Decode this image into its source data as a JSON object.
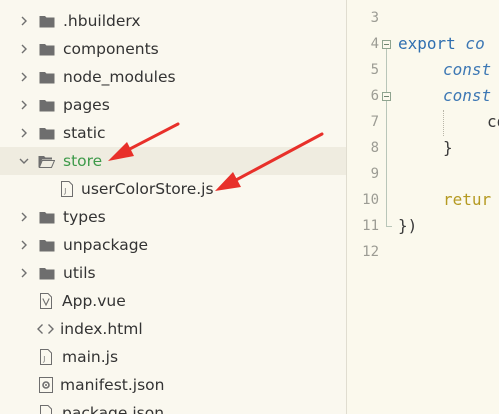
{
  "file_tree": {
    "items": [
      {
        "label": ".hbuilderx",
        "kind": "folder",
        "expanded": false
      },
      {
        "label": "components",
        "kind": "folder",
        "expanded": false
      },
      {
        "label": "node_modules",
        "kind": "folder",
        "expanded": false
      },
      {
        "label": "pages",
        "kind": "folder",
        "expanded": false
      },
      {
        "label": "static",
        "kind": "folder",
        "expanded": false
      },
      {
        "label": "store",
        "kind": "folder",
        "expanded": true,
        "selected": true
      },
      {
        "label": "userColorStore.js",
        "kind": "js-file"
      },
      {
        "label": "types",
        "kind": "folder",
        "expanded": false
      },
      {
        "label": "unpackage",
        "kind": "folder",
        "expanded": false
      },
      {
        "label": "utils",
        "kind": "folder",
        "expanded": false
      },
      {
        "label": "App.vue",
        "kind": "vue-file"
      },
      {
        "label": "index.html",
        "kind": "html-file"
      },
      {
        "label": "main.js",
        "kind": "js-file"
      },
      {
        "label": "manifest.json",
        "kind": "json-file"
      },
      {
        "label": "package.json",
        "kind": "file"
      }
    ]
  },
  "editor": {
    "lines": [
      {
        "num": "3",
        "text": ""
      },
      {
        "num": "4",
        "kw": "export",
        "rest": " co"
      },
      {
        "num": "5",
        "kw": "const",
        "rest": ""
      },
      {
        "num": "6",
        "kw": "const",
        "rest": ""
      },
      {
        "num": "7",
        "kw": "",
        "rest": "co"
      },
      {
        "num": "8",
        "kw": "",
        "rest": "}"
      },
      {
        "num": "9",
        "kw": "",
        "rest": ""
      },
      {
        "num": "10",
        "kw": "retur",
        "rest": ""
      },
      {
        "num": "11",
        "kw": "",
        "rest": "})"
      },
      {
        "num": "12",
        "kw": "",
        "rest": ""
      }
    ]
  },
  "colors": {
    "selected_label": "#3e9a4a",
    "keyword": "#2f6fb0",
    "return_keyword": "#b59a22",
    "annotation_arrow": "#e8302a"
  }
}
